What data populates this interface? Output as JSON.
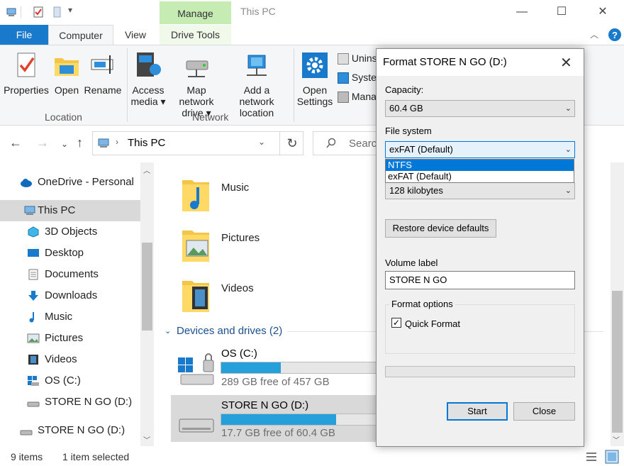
{
  "window": {
    "manage_tab": "Manage",
    "title": "This PC",
    "minimize": "—",
    "maximize": "☐",
    "close": "✕"
  },
  "ribbon_tabs": {
    "file": "File",
    "computer": "Computer",
    "view": "View",
    "drive_tools": "Drive Tools"
  },
  "ribbon": {
    "properties": "Properties",
    "open": "Open",
    "rename": "Rename",
    "access_media": "Access media ▾",
    "map_network_drive": "Map network drive ▾",
    "add_network_location": "Add a network location",
    "open_settings": "Open Settings",
    "uninstall": "Uninst",
    "system": "Syster",
    "manage": "Mana",
    "group_location": "Location",
    "group_network": "Network"
  },
  "address": {
    "path": "This PC",
    "search_placeholder": "Search"
  },
  "nav_pane": {
    "items": [
      {
        "label": "OneDrive - Personal"
      },
      {
        "label": "This PC"
      },
      {
        "label": "3D Objects"
      },
      {
        "label": "Desktop"
      },
      {
        "label": "Documents"
      },
      {
        "label": "Downloads"
      },
      {
        "label": "Music"
      },
      {
        "label": "Pictures"
      },
      {
        "label": "Videos"
      },
      {
        "label": "OS (C:)"
      },
      {
        "label": "STORE N GO (D:)"
      },
      {
        "label": "STORE N GO (D:)"
      }
    ]
  },
  "content": {
    "folders": [
      {
        "label": "Music"
      },
      {
        "label": "Pictures"
      },
      {
        "label": "Videos"
      }
    ],
    "devices_header": "Devices and drives (2)",
    "drives": [
      {
        "name": "OS (C:)",
        "free_text": "289 GB free of 457 GB",
        "used_fraction": 0.37
      },
      {
        "name": "STORE N GO (D:)",
        "free_text": "17.7 GB free of 60.4 GB",
        "used_fraction": 0.71
      }
    ]
  },
  "status": {
    "items": "9 items",
    "selected": "1 item selected"
  },
  "dialog": {
    "title": "Format STORE N GO (D:)",
    "capacity_label": "Capacity:",
    "capacity_value": "60.4 GB",
    "fs_label": "File system",
    "fs_value": "exFAT (Default)",
    "fs_options": [
      "NTFS",
      "exFAT (Default)"
    ],
    "alloc_value": "128 kilobytes",
    "restore_button": "Restore device defaults",
    "volume_label": "Volume label",
    "volume_value": "STORE N GO",
    "format_options_label": "Format options",
    "quick_format_label": "Quick Format",
    "quick_format_checked": true,
    "progress": 0,
    "start_button": "Start",
    "close_button": "Close"
  },
  "colors": {
    "accent": "#1979ca",
    "selection": "#0078d7",
    "drive_bar": "#26a0da",
    "manage_tab": "#c7ecb3"
  }
}
